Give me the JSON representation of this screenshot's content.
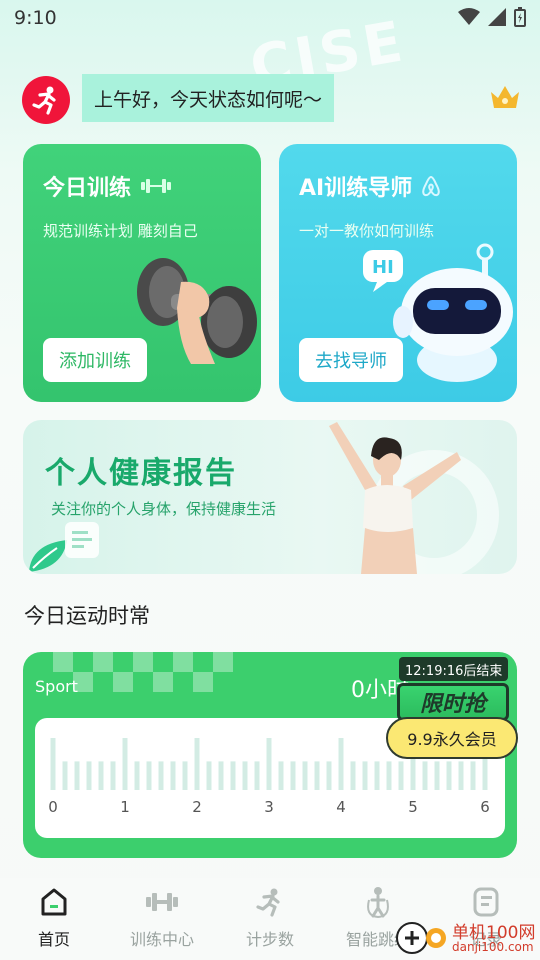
{
  "status_bar": {
    "time": "9:10"
  },
  "background_word": "CISE",
  "greeting": {
    "text": "上午好，今天状态如何呢～"
  },
  "cards": {
    "train": {
      "title": "今日训练",
      "subtitle": "规范训练计划 雕刻自己",
      "button": "添加训练"
    },
    "ai": {
      "title": "AI训练导师",
      "subtitle": "一对一教你如何训练",
      "button": "去找导师",
      "bubble": "HI"
    }
  },
  "report": {
    "title": "个人健康报告",
    "subtitle": "关注你的个人身体，保持健康生活"
  },
  "section": {
    "title": "今日运动时常"
  },
  "sport": {
    "label": "Sport",
    "value": "0小时"
  },
  "chart_data": {
    "type": "bar",
    "x_ticks": [
      "0",
      "1",
      "2",
      "3",
      "4",
      "5",
      "6"
    ],
    "values": [
      0,
      0,
      0,
      0,
      0,
      0,
      0
    ],
    "xlim": [
      0,
      6
    ]
  },
  "promo": {
    "countdown": "12:19:16后结束",
    "title": "限时抢",
    "price": "9.9永久会员"
  },
  "nav": [
    {
      "label": "首页",
      "icon": "home-icon",
      "active": true
    },
    {
      "label": "训练中心",
      "icon": "dumbbell-icon",
      "active": false
    },
    {
      "label": "计步数",
      "icon": "running-icon",
      "active": false
    },
    {
      "label": "智能跳绳",
      "icon": "jump-rope-icon",
      "active": false
    },
    {
      "label": "记录",
      "icon": "record-icon",
      "active": false
    }
  ],
  "site_watermark": {
    "name": "单机100网",
    "url": "danji100.com"
  },
  "colors": {
    "green": "#3ccf6d",
    "cyan": "#3dcbe6",
    "red": "#f0153a",
    "yellow": "#fbe873"
  }
}
